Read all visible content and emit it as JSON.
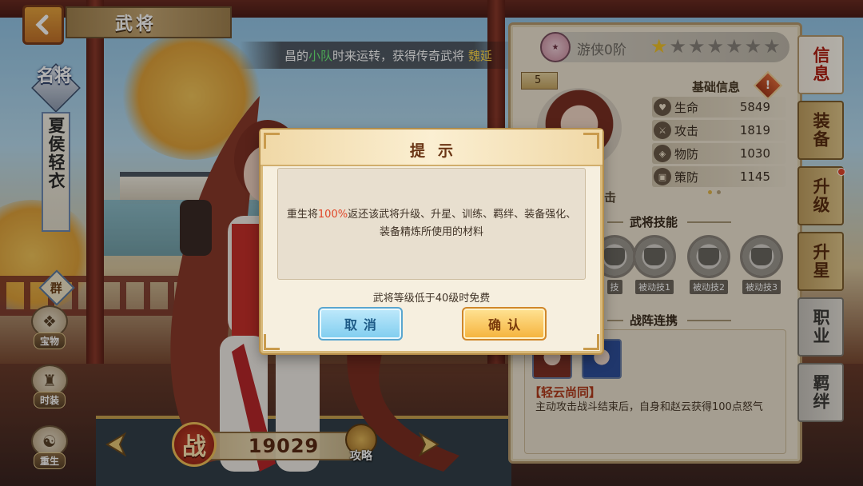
{
  "header": {
    "title": "武将"
  },
  "marquee": {
    "prefix": "昌的",
    "team": "小队",
    "middle": "时来运转，获得传奇武将",
    "hero": "魏延"
  },
  "general": {
    "rank": "名将",
    "name": "夏侯轻衣",
    "faction": "群"
  },
  "side_menu": [
    {
      "label": "宝物",
      "icon": "treasure-icon"
    },
    {
      "label": "时装",
      "icon": "fashion-icon"
    },
    {
      "label": "重生",
      "icon": "rebirth-icon"
    }
  ],
  "power": {
    "label": "战",
    "value": "19029",
    "guide_label": "攻略"
  },
  "info_panel": {
    "rank_name": "游侠0阶",
    "stars_total": 7,
    "stars_lit": 1,
    "level": "5",
    "basic_title": "基础信息",
    "info_icon": "!",
    "stats": [
      {
        "name": "生命",
        "value": "5849",
        "icon": "heart-icon"
      },
      {
        "name": "攻击",
        "value": "1819",
        "icon": "sword-icon"
      },
      {
        "name": "物防",
        "value": "1030",
        "icon": "shield-icon"
      },
      {
        "name": "策防",
        "value": "1145",
        "icon": "scroll-icon"
      }
    ],
    "hidden_tab_text": "击",
    "skills_title": "武将技能",
    "skills": [
      {
        "label": "技"
      },
      {
        "label": "被动技1"
      },
      {
        "label": "被动技2"
      },
      {
        "label": "被动技3"
      }
    ],
    "formation_title": "战阵连携",
    "combo": {
      "name": "【轻云尚同】",
      "desc": "主动攻击战斗结束后，自身和赵云获得100点怒气"
    }
  },
  "tabs": [
    {
      "label": "信息",
      "state": "active"
    },
    {
      "label": "装备",
      "state": "normal"
    },
    {
      "label": "升级",
      "state": "normal"
    },
    {
      "label": "升星",
      "state": "normal"
    },
    {
      "label": "职业",
      "state": "gray"
    },
    {
      "label": "羁绊",
      "state": "gray"
    }
  ],
  "dialog": {
    "title": "提示",
    "msg_before": "重生将",
    "msg_pct": "100%",
    "msg_after": "返还该武将升级、升星、训练、羁绊、装备强化、",
    "msg_line2": "装备精炼所使用的材料",
    "note": "武将等级低于40级时免费",
    "cancel_label": "取消",
    "confirm_label": "确认"
  },
  "colors": {
    "accent_red": "#e0472a",
    "star_gold": "#f0c22a",
    "cancel_blue": "#7fcdef",
    "confirm_gold": "#f5b23b"
  }
}
